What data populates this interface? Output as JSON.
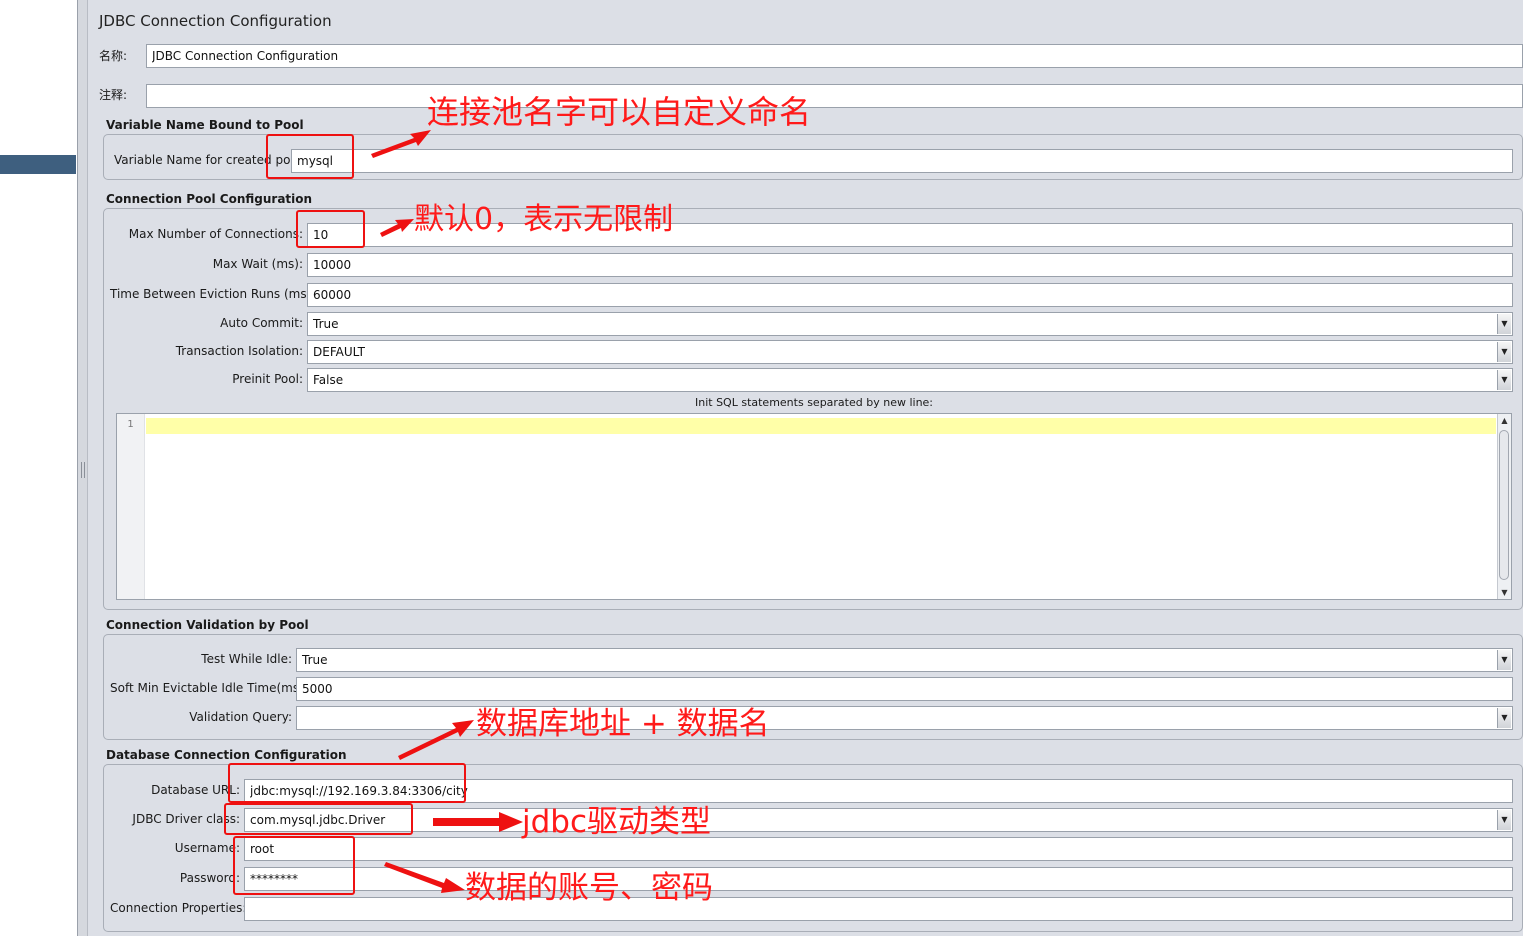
{
  "panel_title": "JDBC Connection Configuration",
  "name": {
    "label": "名称:",
    "value": "JDBC Connection Configuration"
  },
  "comments": {
    "label": "注释:",
    "value": ""
  },
  "sections": {
    "pool_var": "Variable Name Bound to Pool",
    "pool_config": "Connection Pool Configuration",
    "validation": "Connection Validation by Pool",
    "db_config": "Database Connection Configuration"
  },
  "fields": {
    "var_name": {
      "label": "Variable Name for created pool:",
      "value": "mysql"
    },
    "max_conn": {
      "label": "Max Number of Connections:",
      "value": "10"
    },
    "max_wait": {
      "label": "Max Wait (ms):",
      "value": "10000"
    },
    "eviction": {
      "label": "Time Between Eviction Runs (ms):",
      "value": "60000"
    },
    "auto_commit": {
      "label": "Auto Commit:",
      "value": "True"
    },
    "tx_isolation": {
      "label": "Transaction Isolation:",
      "value": "DEFAULT"
    },
    "preinit": {
      "label": "Preinit Pool:",
      "value": "False"
    },
    "init_sql": {
      "label": "Init SQL statements separated by new line:",
      "line_number": "1"
    },
    "test_idle": {
      "label": "Test While Idle:",
      "value": "True"
    },
    "soft_min": {
      "label": "Soft Min Evictable Idle Time(ms):",
      "value": "5000"
    },
    "validation_query": {
      "label": "Validation Query:",
      "value": ""
    },
    "db_url": {
      "label": "Database URL:",
      "value": "jdbc:mysql://192.169.3.84:3306/city"
    },
    "driver": {
      "label": "JDBC Driver class:",
      "value": "com.mysql.jdbc.Driver"
    },
    "username": {
      "label": "Username:",
      "value": "root"
    },
    "password": {
      "label": "Password:",
      "value": "********"
    },
    "conn_props": {
      "label": "Connection Properties:",
      "value": ""
    }
  },
  "annotations": {
    "pool_name": "连接池名字可以自定义命名",
    "default_zero": "默认0，表示无限制",
    "db_address": "数据库地址 + 数据名",
    "driver_type": "jdbc驱动类型",
    "account": "数据的账号、密码"
  },
  "colors": {
    "annotation": "#ee1111",
    "highlight_line": "#ffffa8",
    "selection": "#3e5f7f"
  }
}
